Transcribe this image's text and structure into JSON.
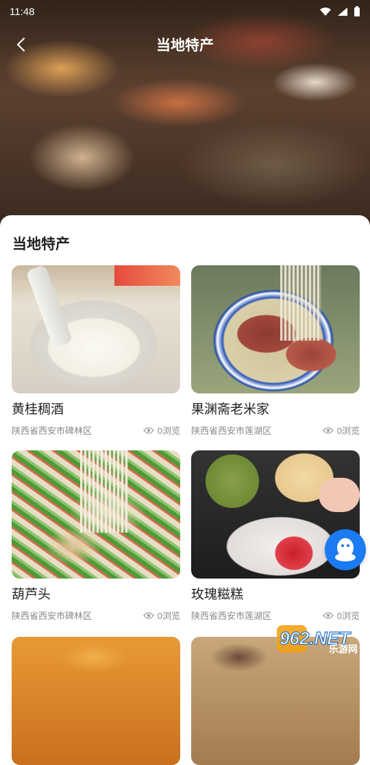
{
  "status": {
    "time": "11:48"
  },
  "header": {
    "title": "当地特产"
  },
  "section": {
    "title": "当地特产"
  },
  "items": [
    {
      "name": "黄桂稠酒",
      "location": "陕西省西安市碑林区",
      "views": "0浏览"
    },
    {
      "name": "果渊斋老米家",
      "location": "陕西省西安市莲湖区",
      "views": "0浏览"
    },
    {
      "name": "葫芦头",
      "location": "陕西省西安市碑林区",
      "views": "0浏览"
    },
    {
      "name": "玫瑰糍糕",
      "location": "陕西省西安市莲湖区",
      "views": "0浏览"
    }
  ],
  "watermark": {
    "brand": "962.NET",
    "sub": "乐游网"
  },
  "colors": {
    "accent": "#1a7bf2",
    "text": "#222222",
    "muted": "#888888"
  }
}
